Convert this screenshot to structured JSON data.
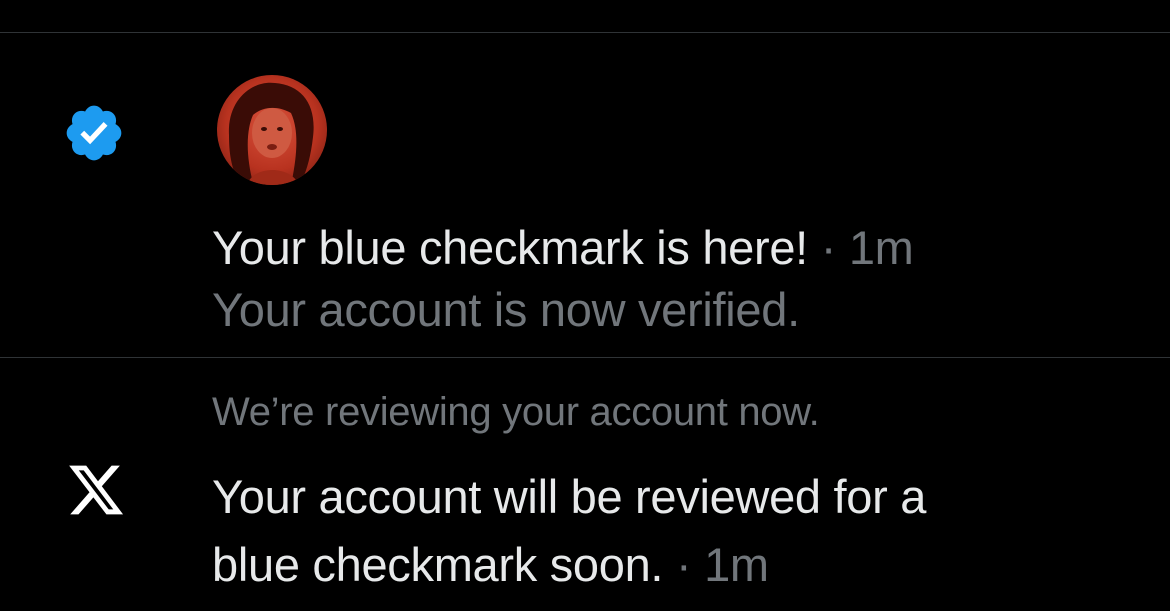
{
  "colors": {
    "background": "#000000",
    "divider": "#2f3336",
    "primary_text": "#e7e9ea",
    "secondary_text": "#71767b",
    "verified_badge": "#1d9bf0",
    "avatar_tint": "#c23b2a"
  },
  "notifications": [
    {
      "icon": "verified-badge-icon",
      "avatar": "profile-photo",
      "title": "Your blue checkmark is here!",
      "separator": "·",
      "time": "1m",
      "subtitle": "Your account is now verified."
    },
    {
      "icon": "x-logo-icon",
      "header": "We’re reviewing your account now.",
      "body_line1": "Your account will be reviewed for a",
      "body_line2": "blue checkmark soon.",
      "separator": "·",
      "time": "1m"
    }
  ]
}
